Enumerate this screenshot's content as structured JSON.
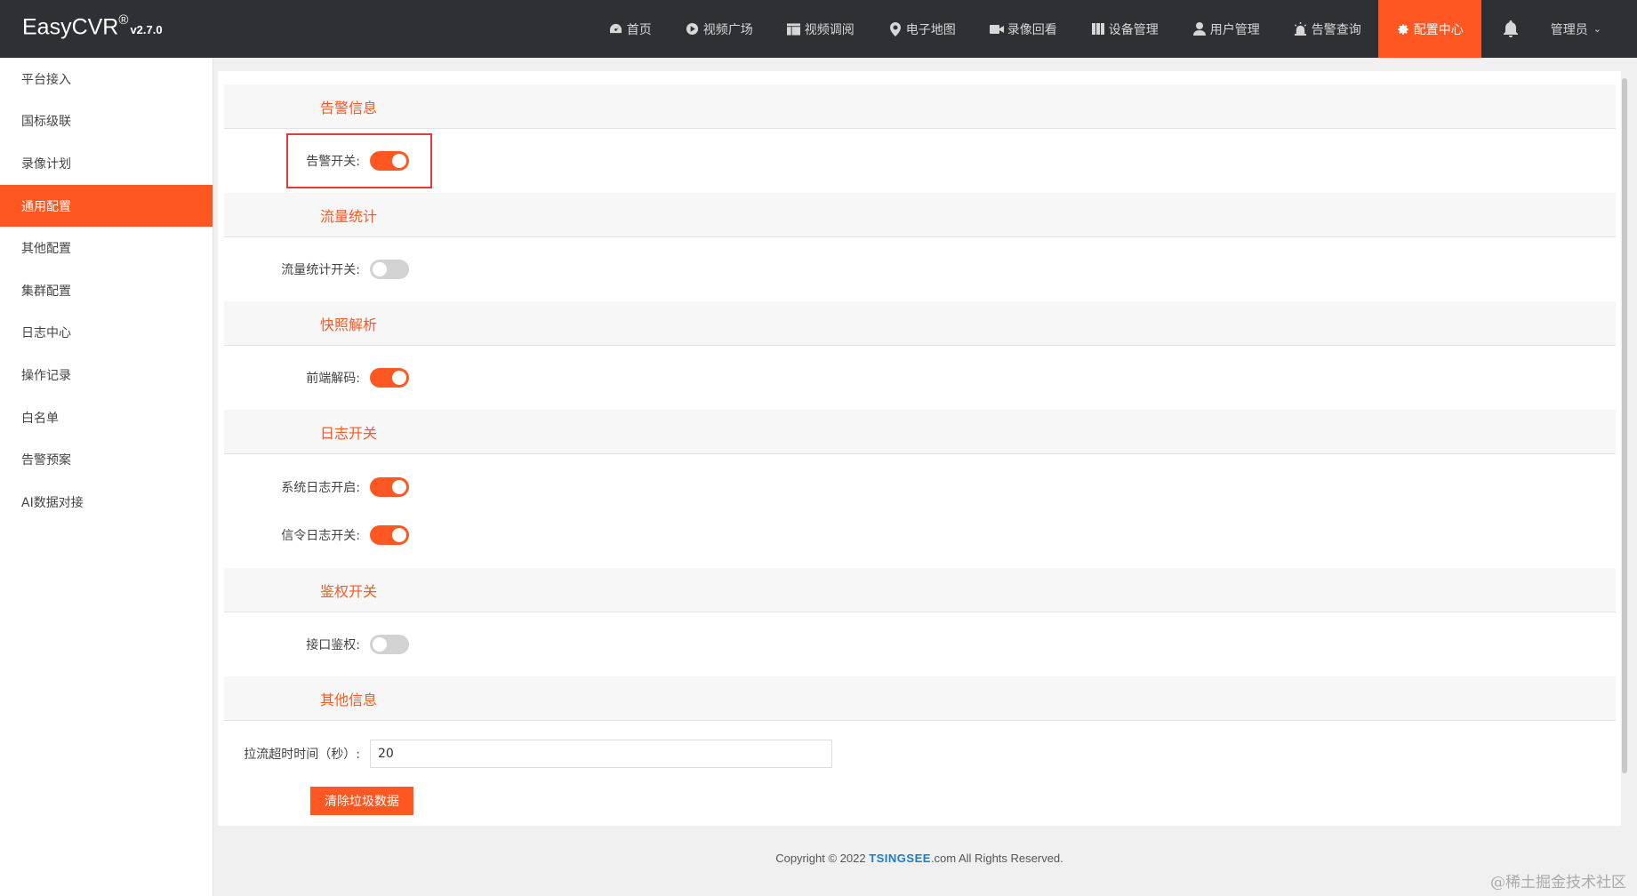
{
  "brand": {
    "name": "EasyCVR",
    "reg": "®",
    "version": "v2.7.0"
  },
  "nav": [
    {
      "label": "首页",
      "icon": "dashboard-icon"
    },
    {
      "label": "视频广场",
      "icon": "play-circle-icon"
    },
    {
      "label": "视频调阅",
      "icon": "layout-icon"
    },
    {
      "label": "电子地图",
      "icon": "map-pin-icon"
    },
    {
      "label": "录像回看",
      "icon": "video-camera-icon"
    },
    {
      "label": "设备管理",
      "icon": "columns-icon"
    },
    {
      "label": "用户管理",
      "icon": "user-icon"
    },
    {
      "label": "告警查询",
      "icon": "alarm-icon"
    },
    {
      "label": "配置中心",
      "icon": "gear-icon",
      "active": true
    }
  ],
  "user": {
    "name": "管理员"
  },
  "sidebar": [
    "平台接入",
    "国标级联",
    "录像计划",
    "通用配置",
    "其他配置",
    "集群配置",
    "日志中心",
    "操作记录",
    "白名单",
    "告警预案",
    "AI数据对接"
  ],
  "sidebar_active": "通用配置",
  "sections": {
    "alarm": {
      "title": "告警信息",
      "label": "告警开关:",
      "on": true
    },
    "flow": {
      "title": "流量统计",
      "label": "流量统计开关:",
      "on": false
    },
    "snapshot": {
      "title": "快照解析",
      "label": "前端解码:",
      "on": true
    },
    "log": {
      "title": "日志开关",
      "sys_label": "系统日志开启:",
      "sys_on": true,
      "sig_label": "信令日志开关:",
      "sig_on": true
    },
    "auth": {
      "title": "鉴权开关",
      "label": "接口鉴权:",
      "on": false
    },
    "other": {
      "title": "其他信息",
      "timeout_label": "拉流超时时间（秒）:",
      "timeout_value": "20",
      "clear_button": "清除垃圾数据"
    }
  },
  "footer": {
    "prefix": "Copyright © 2022 ",
    "brand": "TSINGSEE",
    "suffix": ".com All Rights Reserved."
  },
  "watermark": "@稀土掘金技术社区",
  "colors": {
    "accent": "#ff5722",
    "topbar": "#2f3033"
  }
}
